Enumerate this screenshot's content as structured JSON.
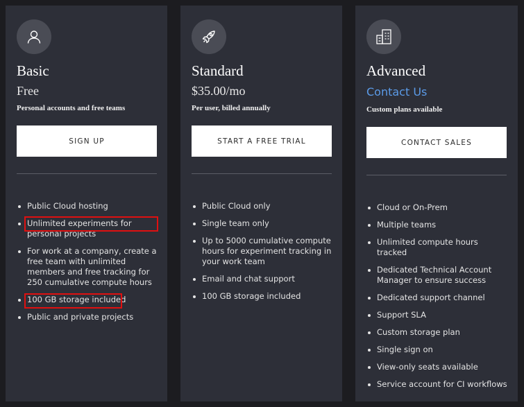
{
  "plans": [
    {
      "icon": "user-icon",
      "name": "Basic",
      "price": "Free",
      "subtitle": "Personal accounts and free teams",
      "cta_label": "SIGN UP",
      "features": [
        "Public Cloud hosting",
        "Unlimited experiments for personal projects",
        "For work at a company, create a free team with unlimited members and free tracking for 250 cumulative compute hours",
        "100 GB storage included",
        "Public and private projects"
      ]
    },
    {
      "icon": "rocket-icon",
      "name": "Standard",
      "price": "$35.00/mo",
      "subtitle": "Per user, billed annually",
      "cta_label": "START A FREE TRIAL",
      "features": [
        "Public Cloud only",
        "Single team only",
        "Up to 5000 cumulative compute hours for experiment tracking in your work team",
        "Email and chat support",
        "100 GB storage included"
      ]
    },
    {
      "icon": "building-icon",
      "name": "Advanced",
      "price": "Contact Us",
      "subtitle": "Custom plans available",
      "cta_label": "CONTACT SALES",
      "features": [
        "Cloud or On-Prem",
        "Multiple teams",
        "Unlimited compute hours tracked",
        "Dedicated Technical Account Manager to ensure success",
        "Dedicated support channel",
        "Support SLA",
        "Custom storage plan",
        "Single sign on",
        "View-only seats available",
        "Service account for CI workflows"
      ]
    }
  ],
  "colors": {
    "card_bg": "#2d2f38",
    "page_bg": "#1c1c20",
    "link": "#5b9be8",
    "highlight": "#e01010"
  }
}
